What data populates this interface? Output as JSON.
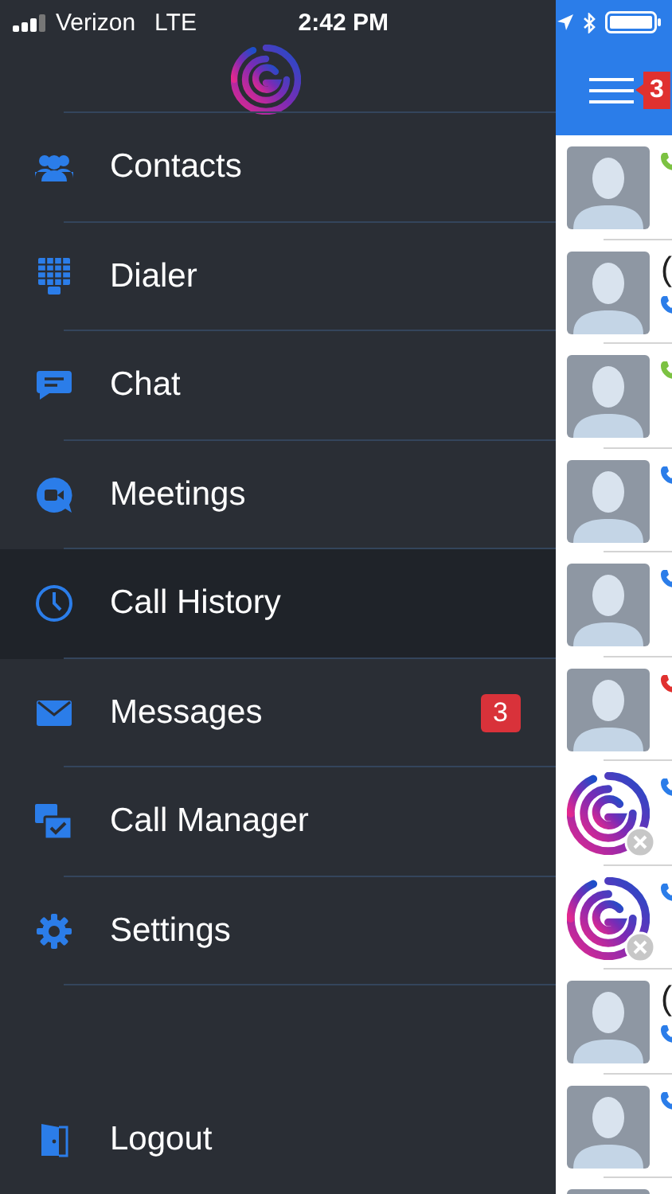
{
  "status_bar": {
    "carrier": "Verizon",
    "network": "LTE",
    "time": "2:42 PM"
  },
  "menu": {
    "items": [
      {
        "label": "Contacts",
        "selected": false
      },
      {
        "label": "Dialer",
        "selected": false
      },
      {
        "label": "Chat",
        "selected": false
      },
      {
        "label": "Meetings",
        "selected": false
      },
      {
        "label": "Call History",
        "selected": true
      },
      {
        "label": "Messages",
        "selected": false,
        "badge": "3"
      },
      {
        "label": "Call Manager",
        "selected": false
      },
      {
        "label": "Settings",
        "selected": false
      }
    ]
  },
  "logout": {
    "label": "Logout"
  },
  "header": {
    "badge": "3"
  },
  "calls": [
    {
      "kind": "person",
      "color": "#7cc242"
    },
    {
      "name": "(",
      "kind": "person",
      "color": "#2b7de9"
    },
    {
      "kind": "person",
      "color": "#7cc242"
    },
    {
      "kind": "person",
      "color": "#2b7de9"
    },
    {
      "kind": "person",
      "color": "#2b7de9"
    },
    {
      "kind": "person",
      "color": "#e0312f"
    },
    {
      "kind": "logo",
      "color": "#2b7de9"
    },
    {
      "kind": "logo",
      "color": "#2b7de9"
    },
    {
      "name": "(",
      "kind": "person",
      "color": "#2b7de9"
    },
    {
      "kind": "person",
      "color": "#2b7de9"
    }
  ]
}
